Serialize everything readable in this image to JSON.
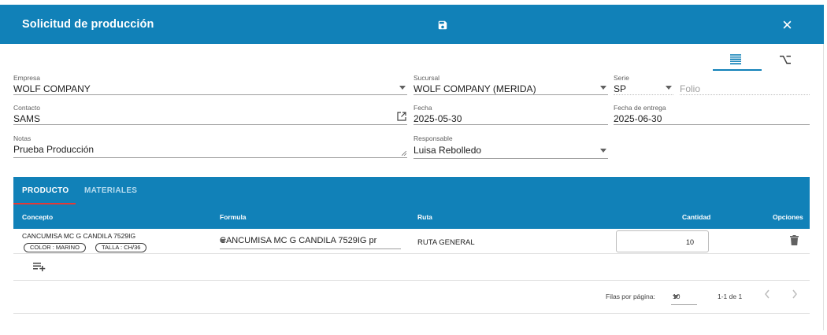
{
  "header": {
    "title": "Solicitud de producción"
  },
  "form": {
    "empresa": {
      "label": "Empresa",
      "value": "WOLF COMPANY"
    },
    "sucursal": {
      "label": "Sucursal",
      "value": "WOLF COMPANY (MERIDA)"
    },
    "serie": {
      "label": "Serie",
      "value": "SP"
    },
    "folio": {
      "placeholder": "Folio"
    },
    "contacto": {
      "label": "Contacto",
      "value": "SAMS"
    },
    "fecha": {
      "label": "Fecha",
      "value": "2025-05-30"
    },
    "fecha_entrega": {
      "label": "Fecha de entrega",
      "value": "2025-06-30"
    },
    "notas": {
      "label": "Notas",
      "value": "Prueba Producción"
    },
    "responsable": {
      "label": "Responsable",
      "value": "Luisa Rebolledo"
    }
  },
  "tabs": [
    {
      "label": "PRODUCTO",
      "active": true
    },
    {
      "label": "MATERIALES",
      "active": false
    }
  ],
  "table": {
    "columns": [
      "Concepto",
      "Formula",
      "Ruta",
      "Cantidad",
      "Opciones"
    ],
    "rows": [
      {
        "concepto": "CANCUMISA MC G CANDILA 7529IG",
        "chips": [
          "COLOR : MARINO",
          "TALLA : CH/36"
        ],
        "formula": "CANCUMISA MC G CANDILA 7529IG pr",
        "ruta": "RUTA GENERAL",
        "cantidad": "10"
      }
    ]
  },
  "pagination": {
    "rows_per_page_label": "Filas por página:",
    "rows_per_page": "10",
    "range": "1-1 de 1"
  },
  "colors": {
    "primary": "#1181b8",
    "tab_indicator": "#e53935"
  }
}
